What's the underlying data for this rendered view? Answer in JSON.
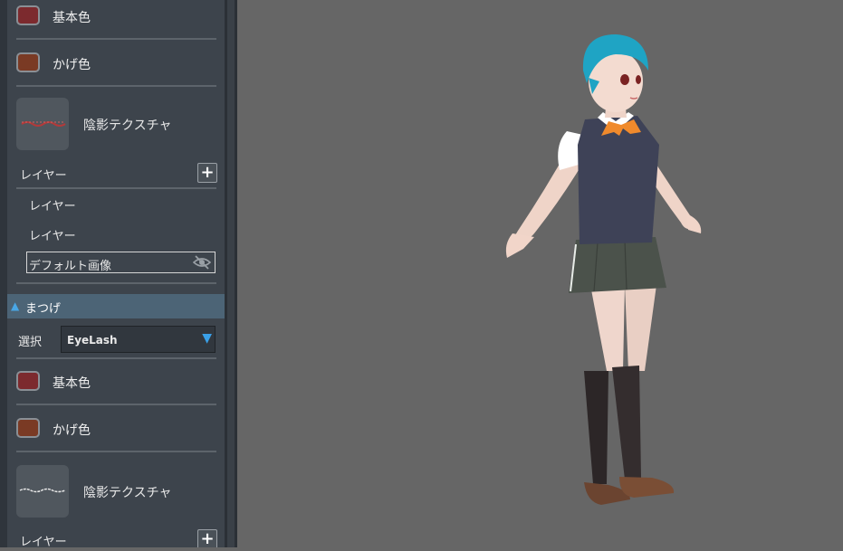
{
  "panel": {
    "top": {
      "base_color": {
        "label": "基本色",
        "color": "#7c2a2e"
      },
      "shade_color": {
        "label": "かげ色",
        "color": "#7a3a24"
      },
      "shade_texture": {
        "label": "陰影テクスチャ"
      },
      "layer_header": "レイヤー",
      "add_icon": "+",
      "layers": [
        "レイヤー",
        "レイヤー"
      ],
      "default_image": "デフォルト画像"
    },
    "eyelash": {
      "header": "まつげ",
      "select_label": "選択",
      "select_value": "EyeLash",
      "base_color": {
        "label": "基本色",
        "color": "#7c2a2e"
      },
      "shade_color": {
        "label": "かげ色",
        "color": "#7a3a24"
      },
      "shade_texture": {
        "label": "陰影テクスチャ"
      },
      "layer_header": "レイヤー",
      "add_icon": "+"
    }
  },
  "colors": {
    "panel_bg": "#3d444c",
    "section_header_bg": "#4c6476",
    "accent": "#3aa0e8",
    "viewport_bg": "#666666"
  },
  "icons": [
    "plus-icon",
    "eye-hidden-icon",
    "triangle-up-icon",
    "dropdown-arrow-icon"
  ]
}
